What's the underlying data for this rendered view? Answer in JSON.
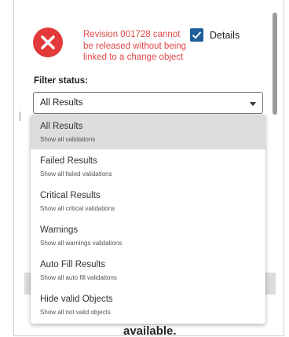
{
  "status": {
    "icon": "error-x-icon",
    "message": "Revision 001728 cannot be released without being linked to a change object"
  },
  "details": {
    "label": "Details",
    "checked": true
  },
  "filter": {
    "label": "Filter status:",
    "selected": "All Results",
    "options": [
      {
        "title": "All Results",
        "description": "Show all validations"
      },
      {
        "title": "Failed Results",
        "description": "Show all failed validations"
      },
      {
        "title": "Critical Results",
        "description": "Show all critical validations"
      },
      {
        "title": "Warnings",
        "description": "Show all warnings validations"
      },
      {
        "title": "Auto Fill Results",
        "description": "Show all auto fill validations"
      },
      {
        "title": "Hide valid Objects",
        "description": "Show all not valid objects"
      }
    ]
  },
  "background": {
    "partial_text": "available."
  },
  "colors": {
    "error": "#e23a3a",
    "checkbox": "#1b5e9b",
    "selected_option": "#dddddd"
  }
}
